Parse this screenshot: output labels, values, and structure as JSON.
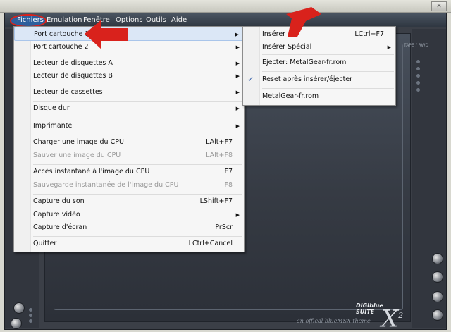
{
  "menubar": {
    "items": [
      "Fichiers",
      "Emulation",
      "Fenêtre",
      "Options",
      "Outils",
      "Aide"
    ]
  },
  "fichiers_menu": {
    "items": [
      {
        "label": "Port cartouche 1",
        "shortcut": "",
        "submenu": true,
        "disabled": false,
        "highlighted": true
      },
      {
        "label": "Port cartouche 2",
        "shortcut": "",
        "submenu": true,
        "disabled": false
      },
      {
        "label": "Lecteur de disquettes A",
        "shortcut": "",
        "submenu": true,
        "disabled": false
      },
      {
        "label": "Lecteur de disquettes B",
        "shortcut": "",
        "submenu": true,
        "disabled": false
      },
      {
        "label": "Lecteur de cassettes",
        "shortcut": "",
        "submenu": true,
        "disabled": false
      },
      {
        "label": "Disque dur",
        "shortcut": "",
        "submenu": true,
        "disabled": false
      },
      {
        "label": "Imprimante",
        "shortcut": "",
        "submenu": true,
        "disabled": false
      },
      {
        "label": "Charger une image du CPU",
        "shortcut": "LAlt+F7",
        "submenu": false,
        "disabled": false
      },
      {
        "label": "Sauver une image du CPU",
        "shortcut": "LAlt+F8",
        "submenu": false,
        "disabled": true
      },
      {
        "label": "Accès instantané à l'image du CPU",
        "shortcut": "F7",
        "submenu": false,
        "disabled": false
      },
      {
        "label": "Sauvegarde instantanée de l'image du CPU",
        "shortcut": "F8",
        "submenu": false,
        "disabled": true
      },
      {
        "label": "Capture du son",
        "shortcut": "LShift+F7",
        "submenu": false,
        "disabled": false
      },
      {
        "label": "Capture vidéo",
        "shortcut": "",
        "submenu": true,
        "disabled": false
      },
      {
        "label": "Capture d'écran",
        "shortcut": "PrScr",
        "submenu": false,
        "disabled": false
      },
      {
        "label": "Quitter",
        "shortcut": "LCtrl+Cancel",
        "submenu": false,
        "disabled": false
      }
    ]
  },
  "cartouche_submenu": {
    "items": [
      {
        "label": "Insérer",
        "shortcut": "LCtrl+F7",
        "submenu": false,
        "checked": false
      },
      {
        "label": "Insérer Spécial",
        "shortcut": "",
        "submenu": true,
        "checked": false
      },
      {
        "label": "Ejecter: MetalGear-fr.rom",
        "shortcut": "",
        "submenu": false,
        "checked": false
      },
      {
        "label": "Reset après insérer/éjecter",
        "shortcut": "",
        "submenu": false,
        "checked": true
      },
      {
        "label": "MetalGear-fr.rom",
        "shortcut": "",
        "submenu": false,
        "checked": false
      }
    ]
  },
  "glyphs": {
    "arrow": "▶",
    "check": "✓",
    "close": "✕"
  },
  "branding": {
    "subtitle": "an offical blueMSX theme",
    "name_line1": "DIGIblue",
    "name_line2": "SUITE",
    "x_mark": "X",
    "x_sup": "2",
    "tape_label": "TAPE / RWD"
  },
  "colors": {
    "menu_highlight": "#dbe7f6",
    "annotation_red": "#d9221c",
    "menubar_active": "#2d5f9c",
    "check_blue": "#2a58a6"
  },
  "icons": [
    "close-icon",
    "checkmark-icon",
    "submenu-arrow-icon",
    "red-arrow-annotation"
  ]
}
